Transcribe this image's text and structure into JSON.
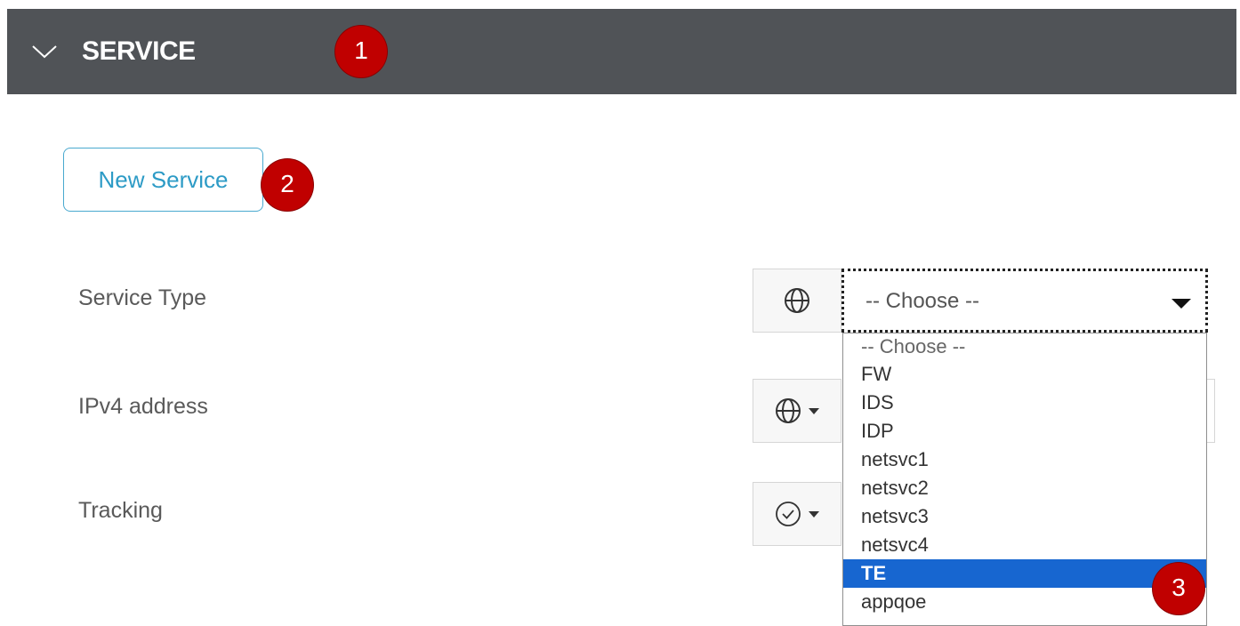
{
  "header": {
    "title": "SERVICE",
    "toggle_icon": "chevron-down-icon",
    "background": "#505357"
  },
  "annotations": {
    "step1": "1",
    "step2": "2",
    "step3": "3",
    "color": "#c00000"
  },
  "new_service_button": {
    "label": "New Service",
    "color": "#2d9bc6"
  },
  "form": {
    "service_type": {
      "label": "Service Type",
      "scope_icon": "globe-icon",
      "selected_value": "-- Choose --",
      "options": [
        "-- Choose --",
        "FW",
        "IDS",
        "IDP",
        "netsvc1",
        "netsvc2",
        "netsvc3",
        "netsvc4",
        "TE",
        "appqoe"
      ],
      "highlighted_option": "TE",
      "highlight_color": "#1766d0"
    },
    "ipv4_address": {
      "label": "IPv4 address",
      "scope_icon": "globe-icon"
    },
    "tracking": {
      "label": "Tracking",
      "scope_icon": "check-circle-icon"
    }
  }
}
